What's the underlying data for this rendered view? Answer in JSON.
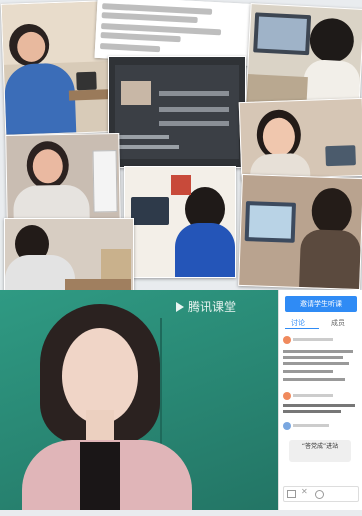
{
  "main_video": {
    "watermark": "腾讯课堂"
  },
  "chat_panel": {
    "tabs": [
      "讨论",
      "成员"
    ],
    "primary_button": "邀请学生听课",
    "notice_pill": "“答党成”进站"
  },
  "colors": {
    "accent": "#2f8bf5",
    "video_bg": "#2a8a76",
    "background": "#e9ecef"
  }
}
